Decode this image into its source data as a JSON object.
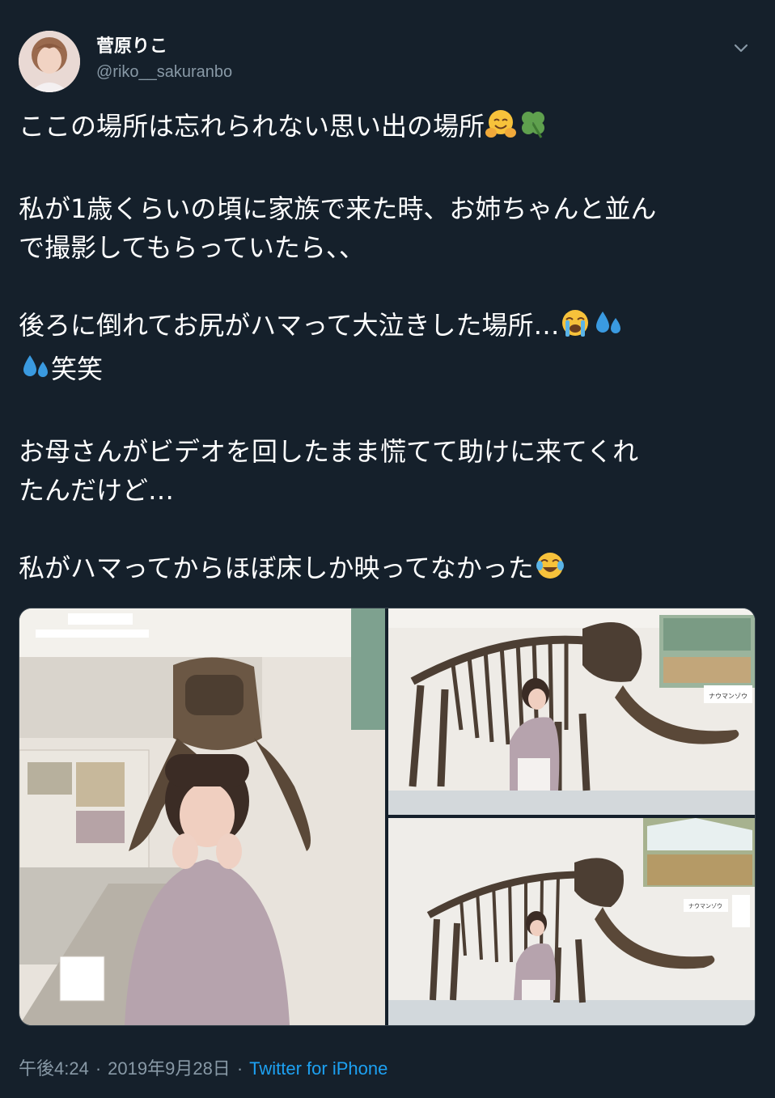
{
  "user": {
    "display_name": "菅原りこ",
    "handle": "@riko__sakuranbo"
  },
  "tweet": {
    "lines": [
      "ここの場所は忘れられない思い出の場所",
      "",
      "私が1歳くらいの頃に家族で来た時、お姉ちゃんと並ん",
      "で撮影してもらっていたら、、",
      "",
      "後ろに倒れてお尻がハマって大泣きした場所…",
      "笑笑",
      "",
      "お母さんがビデオを回したまま慌てて助けに来てくれ",
      "たんだけど…",
      "",
      "私がハマってからほぼ床しか映ってなかった"
    ],
    "emojis": [
      "hugging-face",
      "four-leaf-clover",
      "loudly-crying-face",
      "sweat-droplets",
      "sweat-droplets",
      "face-with-tears-of-joy"
    ]
  },
  "media": {
    "photo_count": 3,
    "photo2_sign": "ナウマンゾウ",
    "photo3_sign": "ナウマンゾウ"
  },
  "meta": {
    "time": "午後4:24",
    "separator": "·",
    "date": "2019年9月28日",
    "source": "Twitter for iPhone"
  },
  "colors": {
    "background": "#15202b",
    "text": "#ffffff",
    "secondary": "#8899a6",
    "link": "#1da1f2"
  }
}
